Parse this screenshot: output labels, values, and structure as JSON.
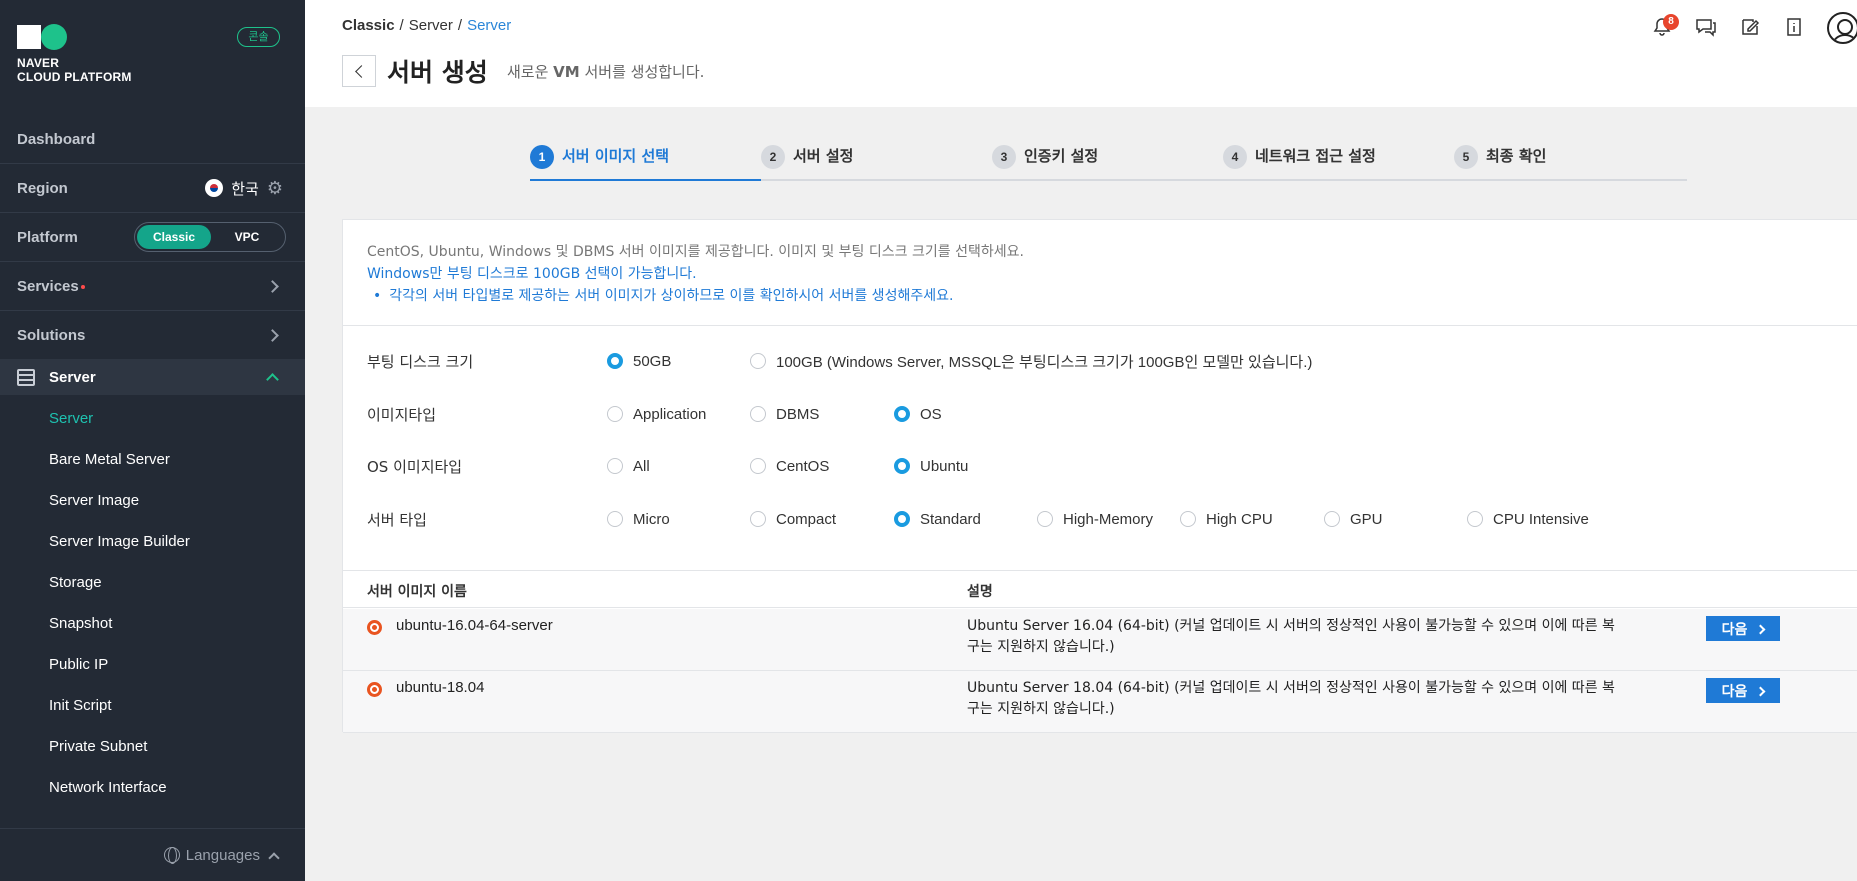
{
  "sidebar": {
    "logo_line1": "NAVER",
    "logo_line2": "CLOUD PLATFORM",
    "console_badge": "콘솔",
    "dashboard": "Dashboard",
    "region_label": "Region",
    "region_value": "한국",
    "platform_label": "Platform",
    "platform_options": [
      "Classic",
      "VPC"
    ],
    "platform_selected": "Classic",
    "services": "Services",
    "solutions": "Solutions",
    "server_section": "Server",
    "submenu": [
      "Server",
      "Bare Metal Server",
      "Server Image",
      "Server Image Builder",
      "Storage",
      "Snapshot",
      "Public IP",
      "Init Script",
      "Private Subnet",
      "Network Interface"
    ],
    "submenu_active": "Server",
    "languages": "Languages"
  },
  "header": {
    "breadcrumb": [
      "Classic",
      "/",
      "Server",
      "/",
      "Server"
    ],
    "title": "서버 생성",
    "subtitle_prefix": "새로운 ",
    "subtitle_bold": "VM",
    "subtitle_suffix": " 서버를 생성합니다.",
    "notification_count": "8"
  },
  "steps": [
    {
      "num": "1",
      "label": "서버 이미지 선택"
    },
    {
      "num": "2",
      "label": "서버 설정"
    },
    {
      "num": "3",
      "label": "인증키 설정"
    },
    {
      "num": "4",
      "label": "네트워크 접근 설정"
    },
    {
      "num": "5",
      "label": "최종 확인"
    }
  ],
  "active_step": 1,
  "info": {
    "line1": "CentOS, Ubuntu, Windows 및 DBMS 서버 이미지를 제공합니다. 이미지 및 부팅 디스크 크기를 선택하세요.",
    "line2": "Windows만 부팅 디스크로 100GB 선택이 가능합니다.",
    "line3": "각각의 서버 타입별로 제공하는 서버 이미지가 상이하므로 이를 확인하시어 서버를 생성해주세요."
  },
  "options": {
    "boot_disk": {
      "label": "부팅 디스크 크기",
      "choices": [
        "50GB",
        "100GB (Windows Server, MSSQL은 부팅디스크 크기가 100GB인 모델만 있습니다.)"
      ],
      "selected": "50GB"
    },
    "image_type": {
      "label": "이미지타입",
      "choices": [
        "Application",
        "DBMS",
        "OS"
      ],
      "selected": "OS"
    },
    "os_image_type": {
      "label": "OS 이미지타입",
      "choices": [
        "All",
        "CentOS",
        "Ubuntu"
      ],
      "selected": "Ubuntu"
    },
    "server_type": {
      "label": "서버 타입",
      "choices": [
        "Micro",
        "Compact",
        "Standard",
        "High-Memory",
        "High CPU",
        "GPU",
        "CPU Intensive"
      ],
      "selected": "Standard"
    }
  },
  "table": {
    "col_name": "서버 이미지 이름",
    "col_desc": "설명",
    "rows": [
      {
        "name": "ubuntu-16.04-64-server",
        "desc": "Ubuntu Server 16.04 (64-bit) (커널 업데이트 시 서버의 정상적인 사용이 불가능할 수 있으며 이에 따른 복구는 지원하지 않습니다.)",
        "action": "다음"
      },
      {
        "name": "ubuntu-18.04",
        "desc": "Ubuntu Server 18.04 (64-bit) (커널 업데이트 시 서버의 정상적인 사용이 불가능할 수 있으며 이에 따른 복구는 지원하지 않습니다.)",
        "action": "다음"
      }
    ]
  },
  "colors": {
    "sidebar_bg": "#232a35",
    "accent_green": "#1ec28b",
    "primary_blue": "#1f7ad6",
    "radio_blue": "#1a9be0",
    "badge_red": "#e8452d"
  }
}
